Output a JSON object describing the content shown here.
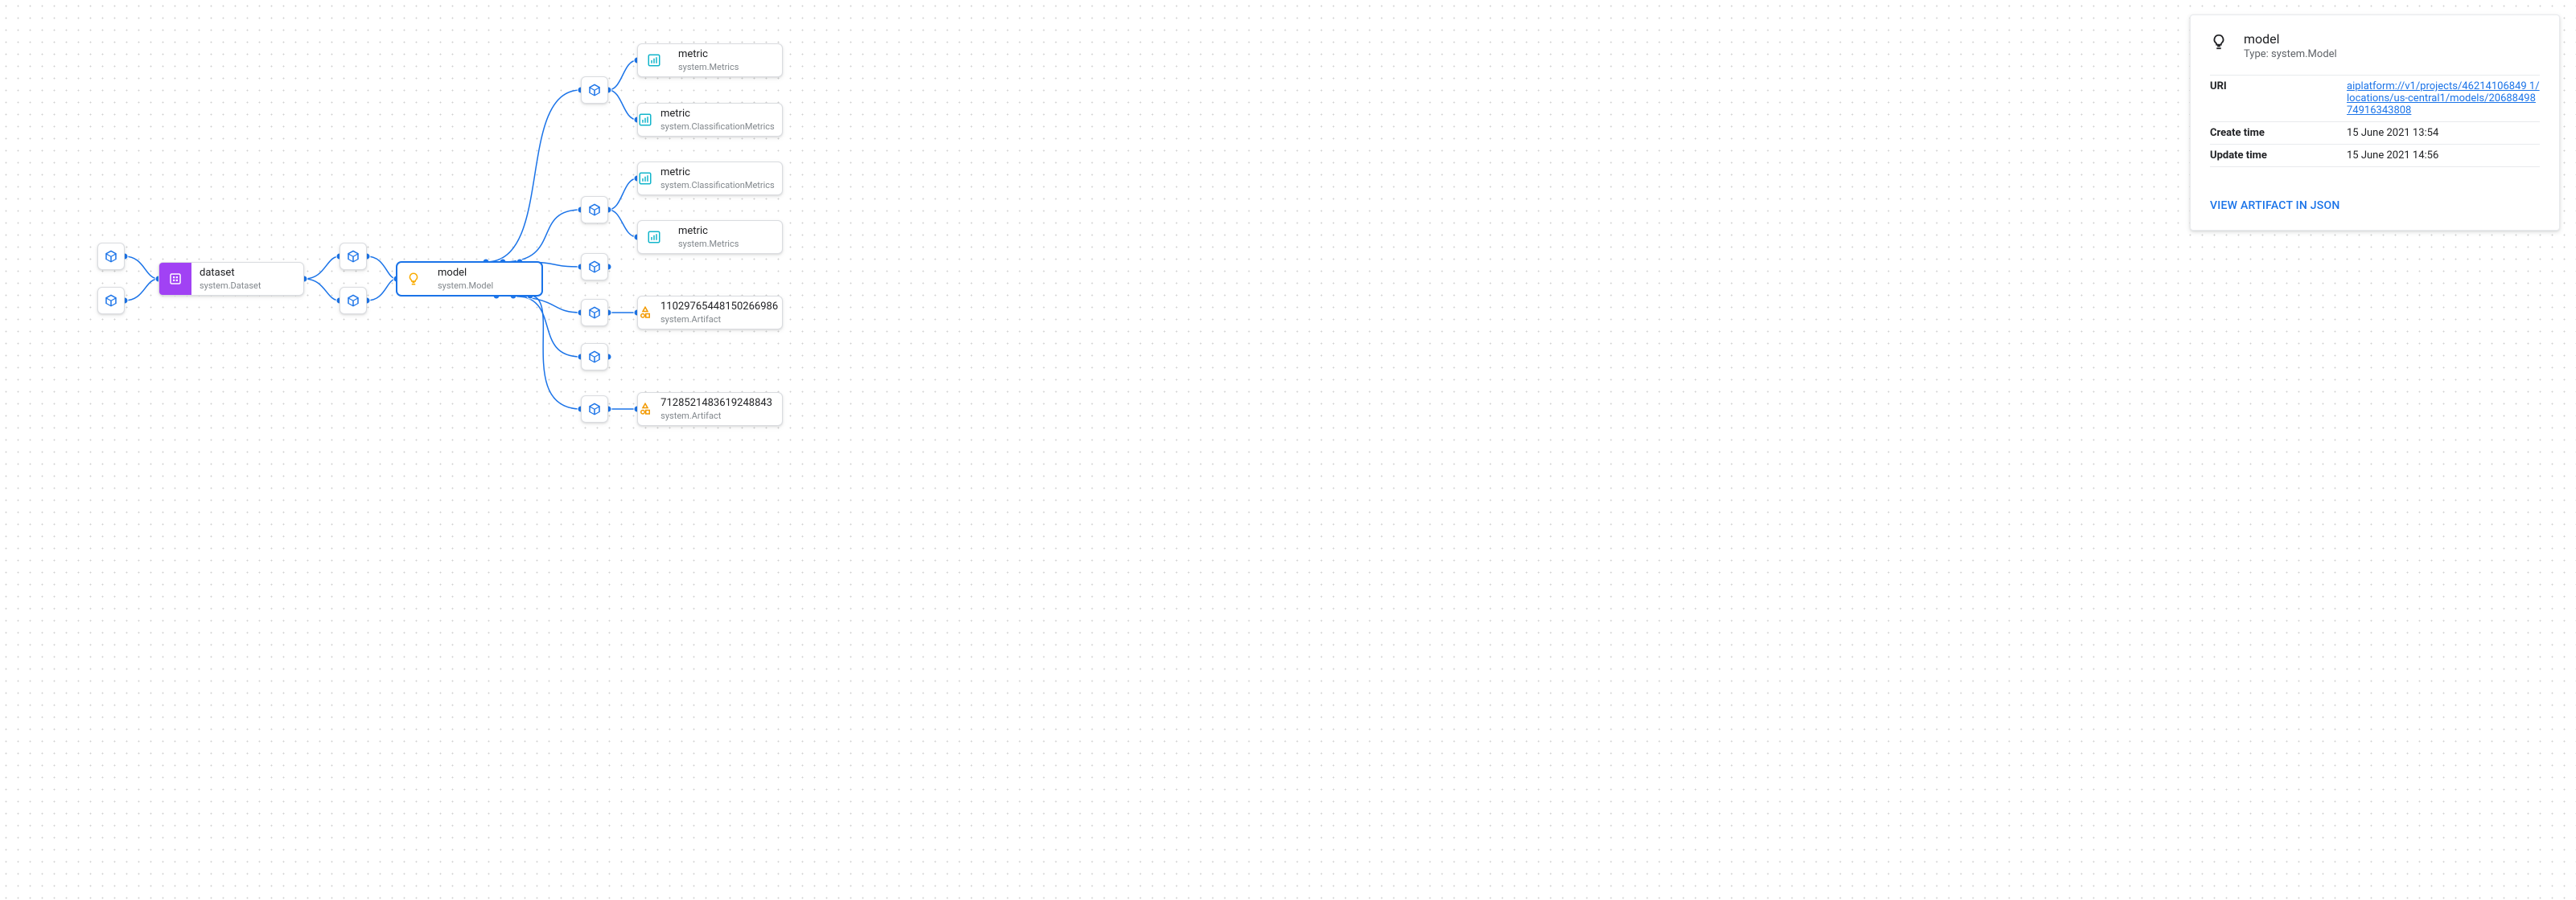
{
  "nodes": {
    "dataset": {
      "title": "dataset",
      "subtitle": "system.Dataset"
    },
    "model": {
      "title": "model",
      "subtitle": "system.Model"
    },
    "metric1": {
      "title": "metric",
      "subtitle": "system.Metrics"
    },
    "metric2": {
      "title": "metric",
      "subtitle": "system.ClassificationMetrics"
    },
    "metric3": {
      "title": "metric",
      "subtitle": "system.ClassificationMetrics"
    },
    "metric4": {
      "title": "metric",
      "subtitle": "system.Metrics"
    },
    "artifact1": {
      "title": "11029765448150266986",
      "subtitle": "system.Artifact"
    },
    "artifact2": {
      "title": "7128521483619248843",
      "subtitle": "system.Artifact"
    }
  },
  "panel": {
    "title": "model",
    "type_label": "Type: system.Model",
    "rows": {
      "uri": {
        "k": "URI",
        "v": "aiplatform://v1/projects/46214106849 1/locations/us-central1/models/2068849874916343808"
      },
      "create": {
        "k": "Create time",
        "v": "15 June 2021 13:54"
      },
      "update": {
        "k": "Update time",
        "v": "15 June 2021 14:56"
      }
    },
    "action": "VIEW ARTIFACT IN JSON"
  }
}
